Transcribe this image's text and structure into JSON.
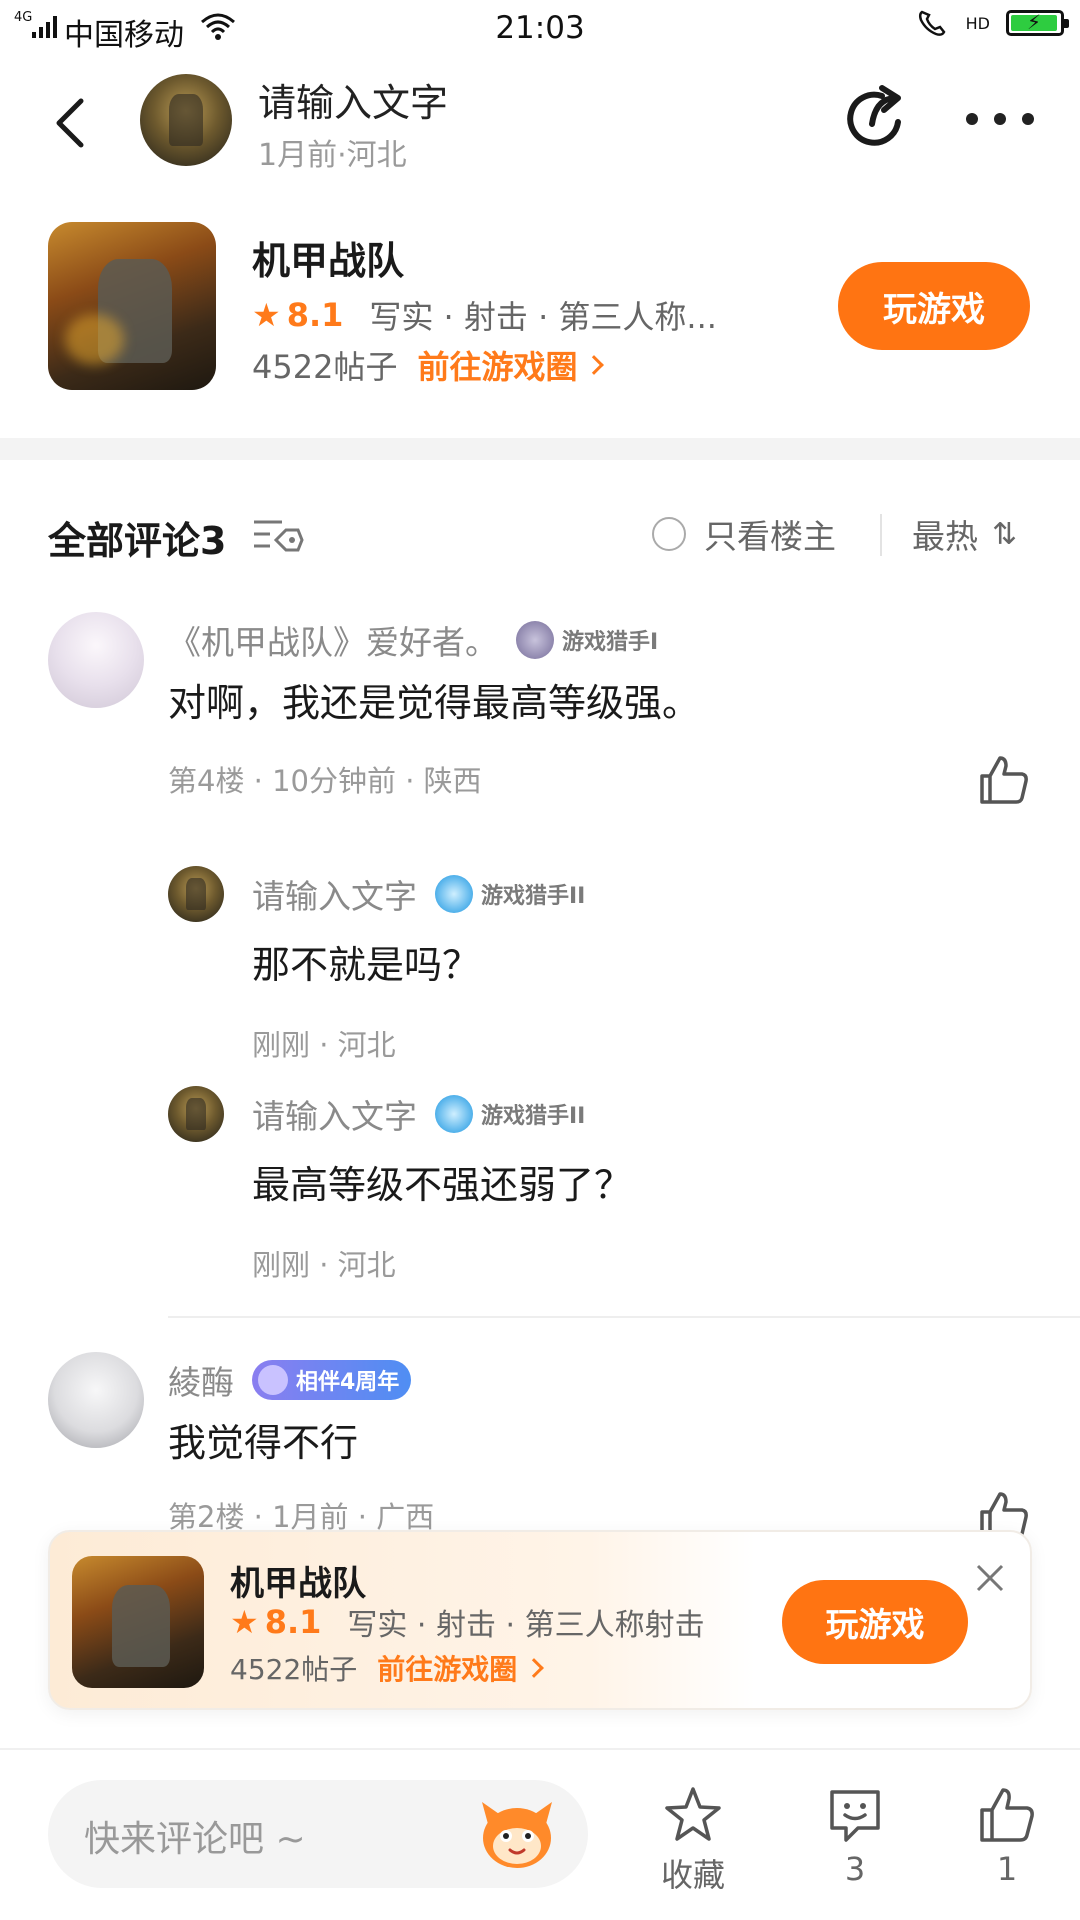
{
  "status_bar": {
    "network": "4G",
    "carrier": "中国移动",
    "time": "21:03",
    "hd": "HD"
  },
  "header": {
    "title": "请输入文字",
    "subtitle": "1月前·河北"
  },
  "game": {
    "name": "机甲战队",
    "rating": "8.1",
    "tags": "写实 · 射击 · 第三人称...",
    "posts": "4522帖子",
    "circle_link": "前往游戏圈",
    "play_label": "玩游戏"
  },
  "comments_header": {
    "title": "全部评论3",
    "op_only": "只看楼主",
    "sort": "最热",
    "sort_icon": "⇅"
  },
  "comments": [
    {
      "author": "《机甲战队》爱好者。",
      "badge": "游戏猎手I",
      "text": "对啊，我还是觉得最高等级强。",
      "meta": "第4楼 · 10分钟前 · 陕西"
    },
    {
      "author": "綾酶",
      "badge": "相伴4周年",
      "text": "我觉得不行",
      "meta": "第2楼 · 1月前 · 广西"
    }
  ],
  "replies": [
    {
      "author": "请输入文字",
      "badge": "游戏猎手II",
      "text": "那不就是吗？",
      "meta": "刚刚 · 河北"
    },
    {
      "author": "请输入文字",
      "badge": "游戏猎手II",
      "text": "最高等级不强还弱了？",
      "meta": "刚刚 · 河北"
    }
  ],
  "floating_card": {
    "name": "机甲战队",
    "rating": "8.1",
    "tags": "写实 · 射击 · 第三人称射击",
    "posts": "4522帖子",
    "circle_link": "前往游戏圈",
    "play_label": "玩游戏"
  },
  "bottom_bar": {
    "input_placeholder": "快来评论吧 ~",
    "favorite_label": "收藏",
    "comment_count": "3",
    "like_count": "1"
  },
  "colors": {
    "accent": "#ff7412",
    "text_primary": "#1a1a1a",
    "text_secondary": "#9a9a9a"
  },
  "icons": [
    "back-arrow-icon",
    "share-icon",
    "more-icon",
    "star-icon",
    "chevron-right-icon",
    "filter-icon",
    "sort-icon",
    "thumbs-up-icon",
    "close-icon",
    "favorite-star-icon",
    "comment-bubble-icon",
    "mascot-icon",
    "wifi-icon",
    "battery-icon"
  ]
}
